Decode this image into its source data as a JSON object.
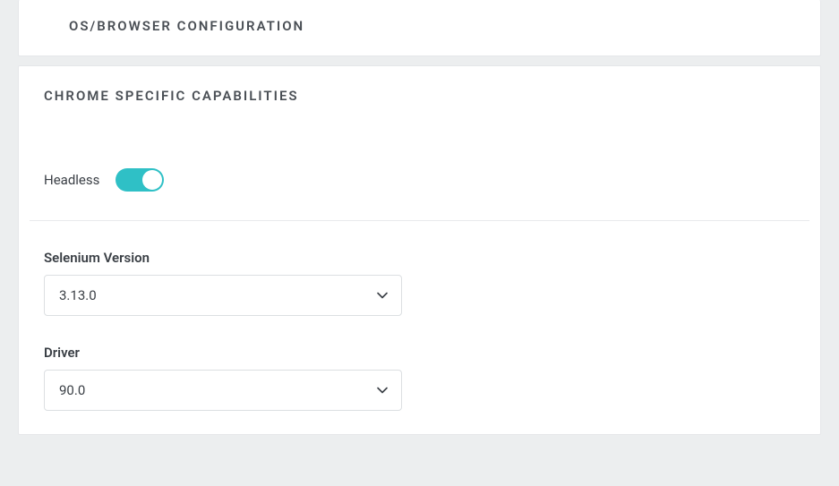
{
  "sections": {
    "os_browser": {
      "title": "OS/BROWSER CONFIGURATION"
    },
    "chrome": {
      "title": "CHROME SPECIFIC CAPABILITIES",
      "headless": {
        "label": "Headless",
        "value": true
      },
      "selenium": {
        "label": "Selenium Version",
        "value": "3.13.0"
      },
      "driver": {
        "label": "Driver",
        "value": "90.0"
      }
    }
  }
}
